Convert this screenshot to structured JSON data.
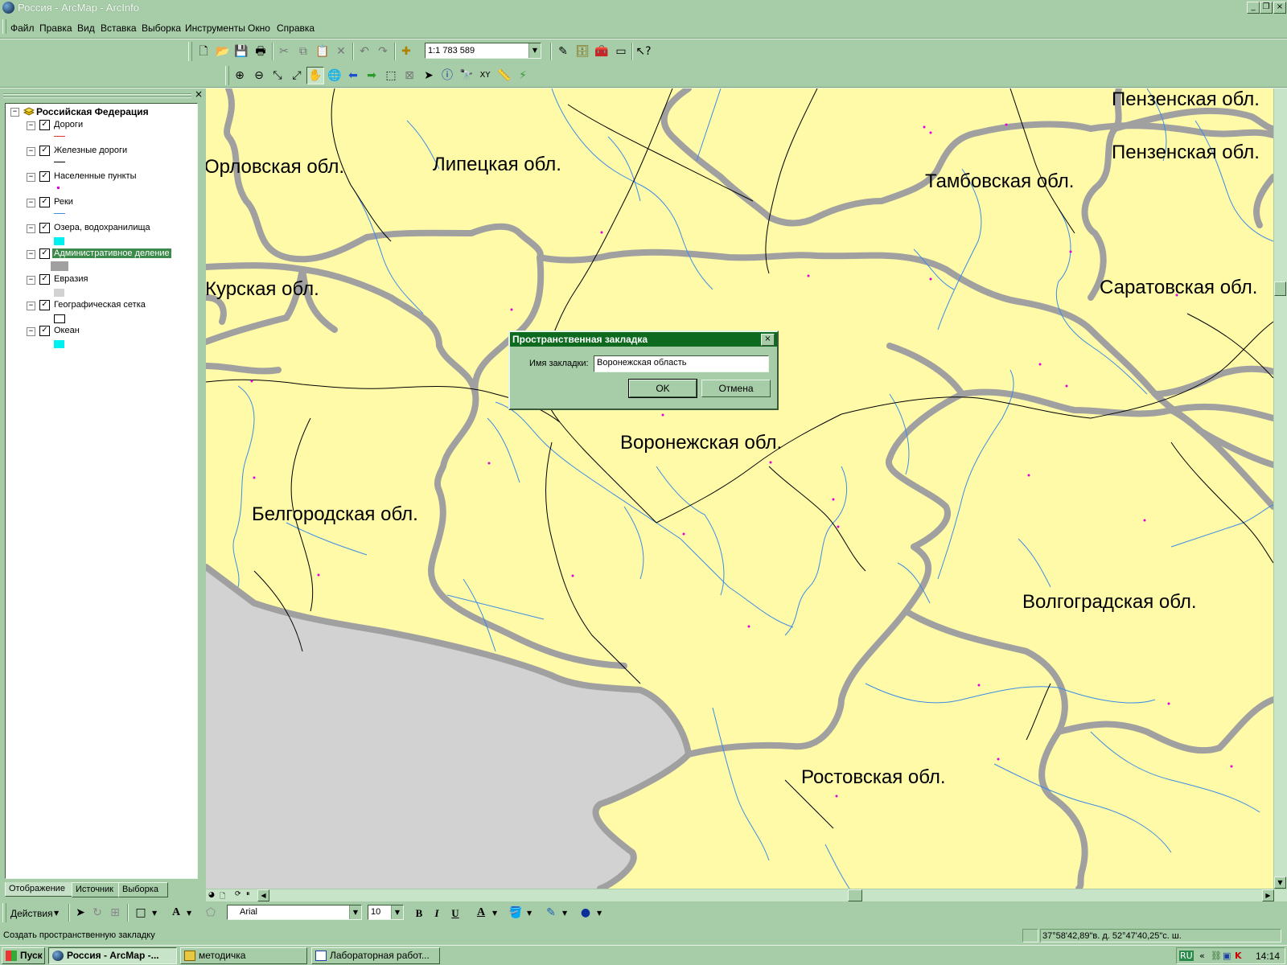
{
  "window": {
    "title": "Россия - ArcMap - ArcInfo",
    "minimize_icon": "minimize-icon",
    "restore_icon": "restore-icon",
    "close_icon": "close-icon"
  },
  "menu": [
    "Файл",
    "Правка",
    "Вид",
    "Вставка",
    "Выборка",
    "Инструменты",
    "Окно",
    "Справка"
  ],
  "standard_toolbar": {
    "scale": "1:1 783 589"
  },
  "toc": {
    "root": "Российская Федерация",
    "layers": [
      {
        "name": "Дороги",
        "checked": true,
        "symbol": "red-line",
        "color": "#e03030"
      },
      {
        "name": "Железные дороги",
        "checked": true,
        "symbol": "black-line",
        "color": "#000000"
      },
      {
        "name": "Населенные пункты",
        "checked": true,
        "symbol": "magenta-point",
        "color": "#e000e0"
      },
      {
        "name": "Реки",
        "checked": true,
        "symbol": "blue-line",
        "color": "#3c8ce6"
      },
      {
        "name": "Озера, водохранилища",
        "checked": true,
        "symbol": "cyan-fill",
        "color": "#00f0f0"
      },
      {
        "name": "Административное деление",
        "checked": true,
        "selected": true,
        "symbol": "gray-fill",
        "color": "#a0a0a0"
      },
      {
        "name": "Евразия",
        "checked": true,
        "symbol": "lightgray-fill",
        "color": "#d2d2d2"
      },
      {
        "name": "Географическая сетка",
        "checked": true,
        "symbol": "empty-box",
        "color": "#ffffff"
      },
      {
        "name": "Океан",
        "checked": true,
        "symbol": "cyan-fill",
        "color": "#00f0f0"
      }
    ],
    "tabs": [
      "Отображение",
      "Источник",
      "Выборка"
    ]
  },
  "map": {
    "colors": {
      "land": "#fffaa8",
      "foreign": "#d2d2d2",
      "boundary": "#a0a0a0",
      "river": "#3c8ce6",
      "rail": "#000000",
      "settlement": "#e000e0"
    },
    "labels": [
      "Пензенская обл.",
      "Пензенская обл.",
      "Орловская обл.",
      "Липецкая обл.",
      "Тамбовская обл.",
      "Курская обл.",
      "Саратовская обл.",
      "Воронежская обл.",
      "Белгородская обл.",
      "Волгоградская обл.",
      "Ростовская обл."
    ]
  },
  "dialog": {
    "title": "Пространственная закладка",
    "label": "Имя закладки:",
    "value": "Воронежская область",
    "ok": "OK",
    "cancel": "Отмена"
  },
  "draw_toolbar": {
    "actions": "Действия",
    "font": "Arial",
    "size": "10",
    "bold": "B",
    "italic": "I",
    "underline": "U"
  },
  "status": {
    "message": "Создать пространственную закладку",
    "coords": "37°58'42,89\"в. д.  52°47'40,25\"с. ш."
  },
  "taskbar": {
    "start": "Пуск",
    "tasks": [
      "Россия - ArcMap -...",
      "методичка",
      "Лабораторная работ..."
    ],
    "lang": "RU",
    "clock": "14:14"
  }
}
